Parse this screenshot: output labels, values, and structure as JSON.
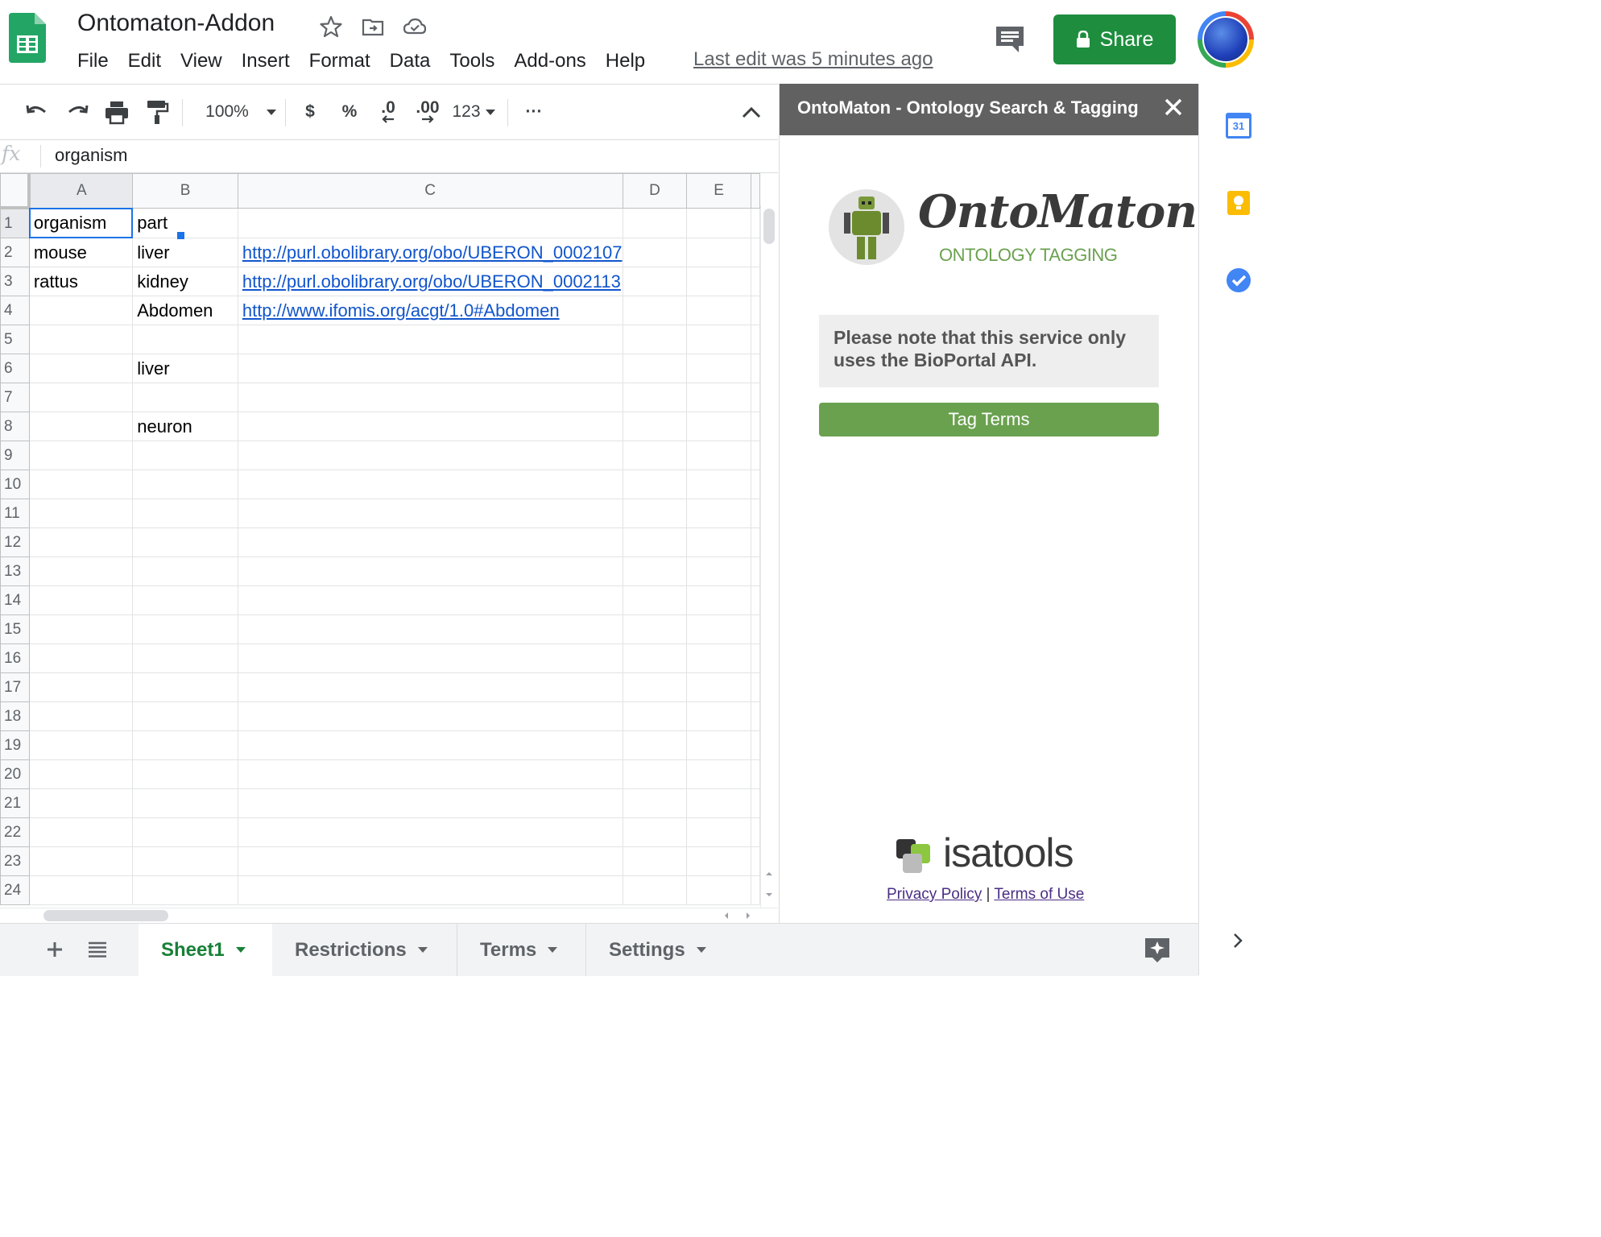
{
  "app": {
    "title": "Ontomaton-Addon",
    "last_edit": "Last edit was 5 minutes ago",
    "share_label": "Share"
  },
  "menu": [
    "File",
    "Edit",
    "View",
    "Insert",
    "Format",
    "Data",
    "Tools",
    "Add-ons",
    "Help"
  ],
  "toolbar": {
    "zoom": "100%",
    "currency": "$",
    "percent": "%",
    "decrease_decimals": ".0",
    "increase_decimals": ".00",
    "number_format": "123",
    "more": "···"
  },
  "formula_bar": {
    "fx": "fx",
    "content": "organism"
  },
  "grid": {
    "columns": [
      "A",
      "B",
      "C",
      "D",
      "E"
    ],
    "selected_cell": "A1",
    "rows": [
      {
        "n": "1",
        "cells": [
          "organism",
          "part",
          "",
          "",
          ""
        ]
      },
      {
        "n": "2",
        "cells": [
          "mouse",
          "liver",
          "http://purl.obolibrary.org/obo/UBERON_0002107",
          "",
          ""
        ]
      },
      {
        "n": "3",
        "cells": [
          "rattus",
          "kidney",
          "http://purl.obolibrary.org/obo/UBERON_0002113",
          "",
          ""
        ]
      },
      {
        "n": "4",
        "cells": [
          "",
          "Abdomen",
          "http://www.ifomis.org/acgt/1.0#Abdomen",
          "",
          ""
        ]
      },
      {
        "n": "5",
        "cells": [
          "",
          "",
          "",
          "",
          ""
        ]
      },
      {
        "n": "6",
        "cells": [
          "",
          "liver",
          "",
          "",
          ""
        ]
      },
      {
        "n": "7",
        "cells": [
          "",
          "",
          "",
          "",
          ""
        ]
      },
      {
        "n": "8",
        "cells": [
          "",
          "neuron",
          "",
          "",
          ""
        ]
      },
      {
        "n": "9",
        "cells": [
          "",
          "",
          "",
          "",
          ""
        ]
      },
      {
        "n": "10",
        "cells": [
          "",
          "",
          "",
          "",
          ""
        ]
      },
      {
        "n": "11",
        "cells": [
          "",
          "",
          "",
          "",
          ""
        ]
      },
      {
        "n": "12",
        "cells": [
          "",
          "",
          "",
          "",
          ""
        ]
      },
      {
        "n": "13",
        "cells": [
          "",
          "",
          "",
          "",
          ""
        ]
      },
      {
        "n": "14",
        "cells": [
          "",
          "",
          "",
          "",
          ""
        ]
      },
      {
        "n": "15",
        "cells": [
          "",
          "",
          "",
          "",
          ""
        ]
      },
      {
        "n": "16",
        "cells": [
          "",
          "",
          "",
          "",
          ""
        ]
      },
      {
        "n": "17",
        "cells": [
          "",
          "",
          "",
          "",
          ""
        ]
      },
      {
        "n": "18",
        "cells": [
          "",
          "",
          "",
          "",
          ""
        ]
      },
      {
        "n": "19",
        "cells": [
          "",
          "",
          "",
          "",
          ""
        ]
      },
      {
        "n": "20",
        "cells": [
          "",
          "",
          "",
          "",
          ""
        ]
      },
      {
        "n": "21",
        "cells": [
          "",
          "",
          "",
          "",
          ""
        ]
      },
      {
        "n": "22",
        "cells": [
          "",
          "",
          "",
          "",
          ""
        ]
      },
      {
        "n": "23",
        "cells": [
          "",
          "",
          "",
          "",
          ""
        ]
      },
      {
        "n": "24",
        "cells": [
          "",
          "",
          "",
          "",
          ""
        ]
      }
    ]
  },
  "sheet_tabs": [
    {
      "label": "Sheet1",
      "active": true
    },
    {
      "label": "Restrictions",
      "active": false
    },
    {
      "label": "Terms",
      "active": false
    },
    {
      "label": "Settings",
      "active": false
    }
  ],
  "panel": {
    "title": "OntoMaton - Ontology Search & Tagging",
    "logo_text": "OntoMaton",
    "logo_subtext": "ONTOLOGY TAGGING",
    "note": "Please note that this service only uses the BioPortal API.",
    "tag_button": "Tag Terms",
    "footer_logo": "isatools",
    "privacy_link": "Privacy Policy",
    "separator": "|",
    "terms_link": "Terms of Use"
  },
  "rail": {
    "calendar_day": "31"
  },
  "colors": {
    "share_green": "#1e8e3e",
    "tag_green": "#6aa14f",
    "panel_header": "#616161",
    "link_blue": "#1155cc",
    "active_tab_green": "#188038"
  }
}
